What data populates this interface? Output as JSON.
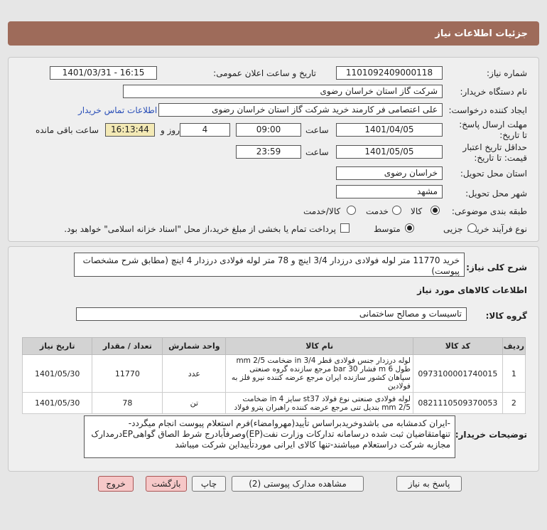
{
  "header": {
    "title": "جزئیات اطلاعات نیاز"
  },
  "info": {
    "need_number_label": "شماره نیاز:",
    "need_number": "1101092409000118",
    "announce_label": "تاریخ و ساعت اعلان عمومی:",
    "announce_value": "1401/03/31 - 16:15",
    "buyer_org_label": "نام دستگاه خریدار:",
    "buyer_org": "شرکت گاز استان خراسان رضوی",
    "creator_label": "ایجاد کننده درخواست:",
    "creator": "علی اعتصامی فر کارمند خرید شرکت گاز استان خراسان رضوی",
    "contact_link": "اطلاعات تماس خریدار",
    "deadline_label": "مهلت ارسال پاسخ: تا تاریخ:",
    "deadline_date": "1401/04/05",
    "time_label": "ساعت",
    "deadline_time": "09:00",
    "days": "4",
    "days_label": "روز و",
    "remaining_time": "16:13:44",
    "remaining_label": "ساعت باقی مانده",
    "validity_label": "حداقل تاریخ اعتبار قیمت: تا تاریخ:",
    "validity_date": "1401/05/05",
    "validity_time": "23:59",
    "province_label": "استان محل تحویل:",
    "province": "خراسان رضوی",
    "city_label": "شهر محل تحویل:",
    "city": "مشهد",
    "category_label": "طبقه بندی موضوعی:",
    "category_options": [
      "کالا",
      "خدمت",
      "کالا/خدمت"
    ],
    "process_label": "نوع فرآیند خرید :",
    "process_options": [
      "جزیی",
      "متوسط"
    ],
    "payment_note": "پرداخت تمام یا بخشی از مبلغ خرید،از محل \"اسناد خزانه اسلامی\" خواهد بود."
  },
  "description": {
    "label": "شرح کلی نیاز:",
    "text": "خرید 11770 متر لوله فولادی درزدار 3/4 اینچ و 78 متر لوله فولادی درزدار 4 اینچ (مطابق شرح مشخصات پیوست)"
  },
  "goods": {
    "section_title": "اطلاعات کالاهای مورد نیاز",
    "group_label": "گروه کالا:",
    "group_value": "تاسیسات و مصالح ساختمانی",
    "columns": [
      "ردیف",
      "کد کالا",
      "نام کالا",
      "واحد شمارش",
      "تعداد / مقدار",
      "تاریخ نیاز"
    ],
    "rows": [
      {
        "row": "1",
        "code": "0973100001740015",
        "name": "لوله درزدار جنس فولادی قطر 3/4 in ضخامت 2/5 mm طول 6 m فشار 30 bar مرجع سازنده گروه صنعتی سپاهان کشور سازنده ایران مرجع عرضه کننده نیرو فلز به فولادین",
        "unit": "عدد",
        "qty": "11770",
        "date": "1401/05/30"
      },
      {
        "row": "2",
        "code": "0821110509370053",
        "name": "لوله فولادی صنعتی نوع فولاد st37 سایز 4 in ضخامت 2/5 mm بندیل تنی مرجع عرضه کننده راهبران پترو فولاد",
        "unit": "تن",
        "qty": "78",
        "date": "1401/05/30"
      }
    ]
  },
  "notes": {
    "label": "توضیحات خریدار:",
    "text": "-ایران کدمشابه می باشدوخریدبراساس تأیید(مهروامضاء)فرم استعلام پیوست انجام میگردد-تنهامتقاضیان ثبت شده درسامانه تدارکات وزارت نفت(EP)وصرفاًبادرج شرط الصاق گواهیEPدرمدارک مجازبه شرکت دراستعلام میباشند-تنها کالای ایرانی موردتأییداین شرکت میباشد"
  },
  "buttons": {
    "reply": "پاسخ به نیاز",
    "attachments": "مشاهده مدارک پیوستی (2)",
    "print": "چاپ",
    "back": "بازگشت",
    "exit": "خروج"
  }
}
